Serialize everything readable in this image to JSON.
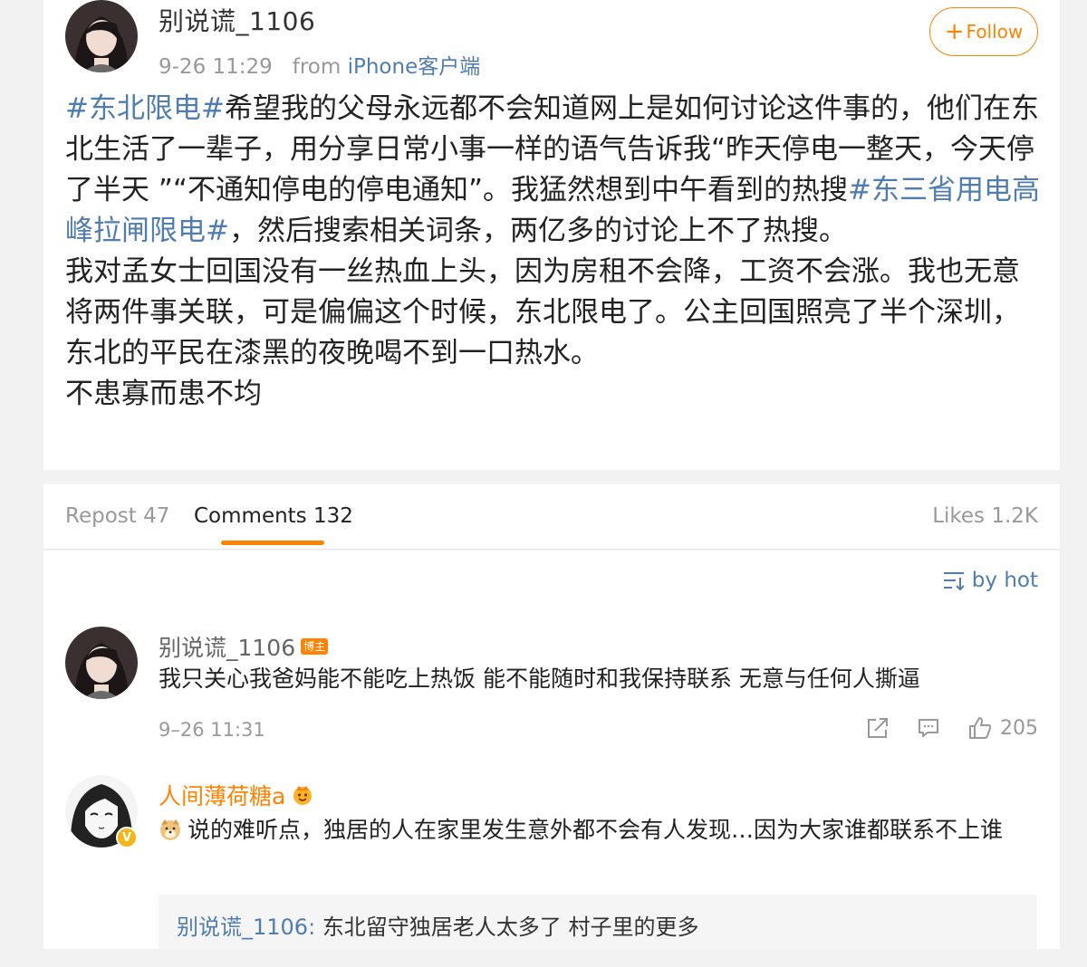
{
  "post": {
    "author": "别说谎_1106",
    "time": "9-26 11:29",
    "from_label": "from",
    "source": "iPhone客户端",
    "follow_label": "Follow",
    "tag1": "#东北限电#",
    "text1": "希望我的父母永远都不会知道网上是如何讨论这件事的，他们在东北生活了一辈子，用分享日常小事一样的语气告诉我“昨天停电一整天，今天停了半天 ”“不通知停电的停电通知”。我猛然想到中午看到的热搜",
    "tag2": "#东三省用电高峰拉闸限电#",
    "text2": "，然后搜索相关词条，两亿多的讨论上不了热搜。",
    "para2": "我对孟女士回国没有一丝热血上头，因为房租不会降，工资不会涨。我也无意将两件事关联，可是偏偏这个时候，东北限电了。公主回国照亮了半个深圳，东北的平民在漆黑的夜晚喝不到一口热水。",
    "para3": "不患寡而患不均"
  },
  "tabs": {
    "repost": "Repost 47",
    "comments": "Comments 132",
    "likes": "Likes 1.2K"
  },
  "sort": {
    "label": "by hot"
  },
  "comments": [
    {
      "author": "别说谎_1106",
      "badge": "博主",
      "text": "我只关心我爸妈能不能吃上热饭 能不能随时和我保持联系 无意与任何人撕逼",
      "time": "9–26 11:31",
      "likes": "205"
    },
    {
      "author": "人间薄荷糖a",
      "text": "说的难听点，独居的人在家里发生意外都不会有人发现…因为大家谁都联系不上谁",
      "reply_author": "别说谎_1106:",
      "reply_text": "东北留守独居老人太多了 村子里的更多"
    }
  ],
  "colors": {
    "accent": "#ff8200",
    "link": "#507daf",
    "muted": "#999999"
  }
}
